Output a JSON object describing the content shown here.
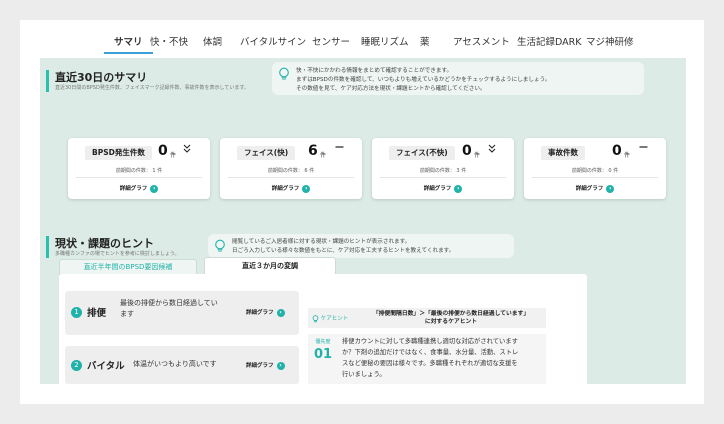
{
  "tabs": [
    "サマリ",
    "快・不快",
    "体調",
    "バイタルサイン",
    "センサー",
    "睡眠リズム",
    "薬",
    "アセスメント",
    "生活記録DARK",
    "マジ神研修"
  ],
  "summary": {
    "title": "直近30日のサマリ",
    "subtitle": "直近30日間のBPSD発生件数、フェイスマーク記録件数、事故件数を表示しています。",
    "info_lines": [
      "快・不快にかかわる情報をまとめて確認することができます。",
      "まずはBPSDの件数を確認して、いつもよりも増えているかどうかをチェックするようにしましょう。",
      "その数値を見て、ケア対応方法を現状・課題ヒントから確認してください。"
    ],
    "cards": [
      {
        "label": "BPSD発生件数",
        "count": "0",
        "unit": "件",
        "trend": "↓",
        "prev": "前期間の件数： 1 件",
        "detail": "詳細グラフ"
      },
      {
        "label": "フェイス(快)",
        "count": "6",
        "unit": "件",
        "trend": "—",
        "prev": "前期間の件数： 6 件",
        "detail": "詳細グラフ"
      },
      {
        "label": "フェイス(不快)",
        "count": "0",
        "unit": "件",
        "trend": "↓",
        "prev": "前期間の件数： 3 件",
        "detail": "詳細グラフ"
      },
      {
        "label": "事故件数",
        "count": "0",
        "unit": "件",
        "trend": "—",
        "prev": "前期間の件数： 0 件",
        "detail": "詳細グラフ"
      }
    ]
  },
  "hints": {
    "title": "現状・課題のヒント",
    "subtitle": "多職種カンファの場でヒントを参考に検討しましょう。",
    "info_lines": [
      "閲覧しているご入居者様に対する現状・課題のヒントが表示されます。",
      "日ごろ入力している様々な数値をもとに、ケア対応を工夫するヒントを教えてくれます。"
    ],
    "tabs": [
      "直近半年間のBPSD要因候補",
      "直近３か月の変調"
    ],
    "rows": [
      {
        "num": "1",
        "name": "排便",
        "desc_lines": [
          "最後の排便から数日経過してい",
          "ます"
        ],
        "detail": "詳細グラフ"
      },
      {
        "num": "2",
        "name": "バイタル",
        "desc_lines": [
          "体温がいつもより高いです"
        ],
        "detail": "詳細グラフ"
      }
    ],
    "care": {
      "tag": "ケアヒント",
      "title_lines": [
        "「排便間隔日数」＞「最後の排便から数日経過しています」",
        "に対するケアヒント"
      ],
      "priority_label": "優先度",
      "priority": "01",
      "text_lines": [
        "排便カウントに対して多職種連携し適切な対応がされています",
        "か？下剤の追加だけではなく、食事量、水分量、活動、ストレ",
        "スなど便秘の要因は様々です。多職種それぞれが適切な支援を",
        "行いましょう。"
      ]
    }
  },
  "colors": {
    "accent": "#20b2a8",
    "tab_underline": "#3a9fd6",
    "content_bg": "#dcebe5"
  }
}
